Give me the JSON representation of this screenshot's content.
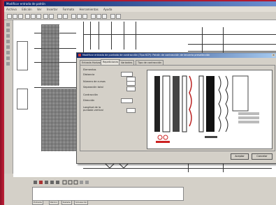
{
  "window": {
    "title": "Modificar entrada de patrón"
  },
  "menu": [
    "Archivo",
    "Edición",
    "Ver",
    "Insertar",
    "Formato",
    "Herramientas",
    "Ayuda"
  ],
  "dialog": {
    "title": "Modificar entrada de puntada de contracción (Tipo KCP): Patrón de contracción de lencería preselección",
    "tabs": [
      "Entrada Horizontal",
      "Repeticiones",
      "Variantes",
      "Tipo de contracción"
    ],
    "fields": [
      {
        "label": "Elementos",
        "value": ""
      },
      {
        "label": "Distancia",
        "value": ""
      },
      {
        "label": "Número de cursos",
        "value": ""
      },
      {
        "label": "Separación total",
        "value": ""
      },
      {
        "label": "Contracción",
        "value": ""
      },
      {
        "label": "Dirección",
        "value": ""
      },
      {
        "label": "Longitud de la puntada vertical",
        "value": ""
      }
    ],
    "ok_label": "Aceptar",
    "cancel_label": "Cancelar"
  },
  "bottom_tabs": [
    "Entrada",
    "Patrón",
    "Detalle",
    "Simulación"
  ],
  "colors": {
    "bezel": "#b0162e",
    "titlebar": "#0a246a",
    "dialog_bg": "#d4d0c8"
  }
}
